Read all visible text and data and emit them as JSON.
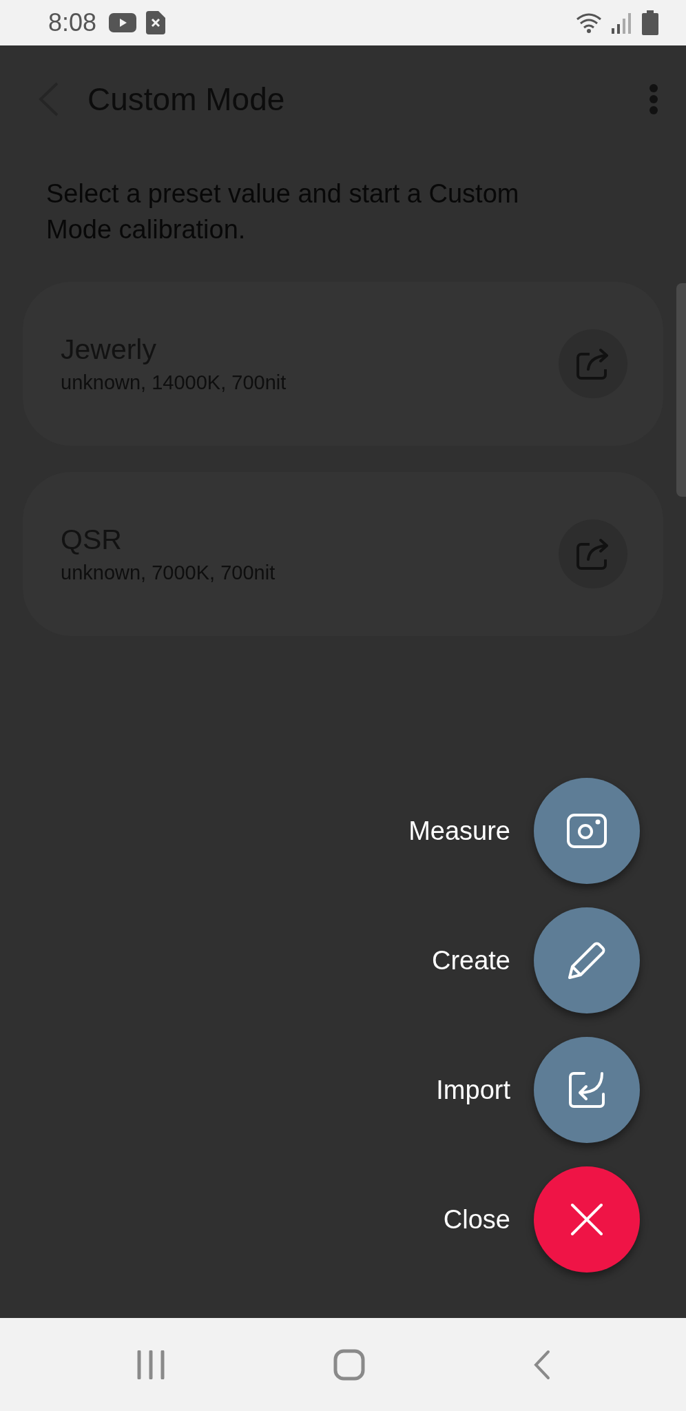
{
  "status_bar": {
    "time": "8:08"
  },
  "header": {
    "title": "Custom Mode"
  },
  "description": "Select a preset value and start a Custom Mode calibration.",
  "presets": [
    {
      "name": "Jewerly",
      "details": "unknown, 14000K, 700nit"
    },
    {
      "name": "QSR",
      "details": "unknown, 7000K, 700nit"
    }
  ],
  "fab_menu": {
    "actions": [
      {
        "label": "Measure",
        "kind": "measure"
      },
      {
        "label": "Create",
        "kind": "create"
      },
      {
        "label": "Import",
        "kind": "import"
      },
      {
        "label": "Close",
        "kind": "close"
      }
    ]
  }
}
